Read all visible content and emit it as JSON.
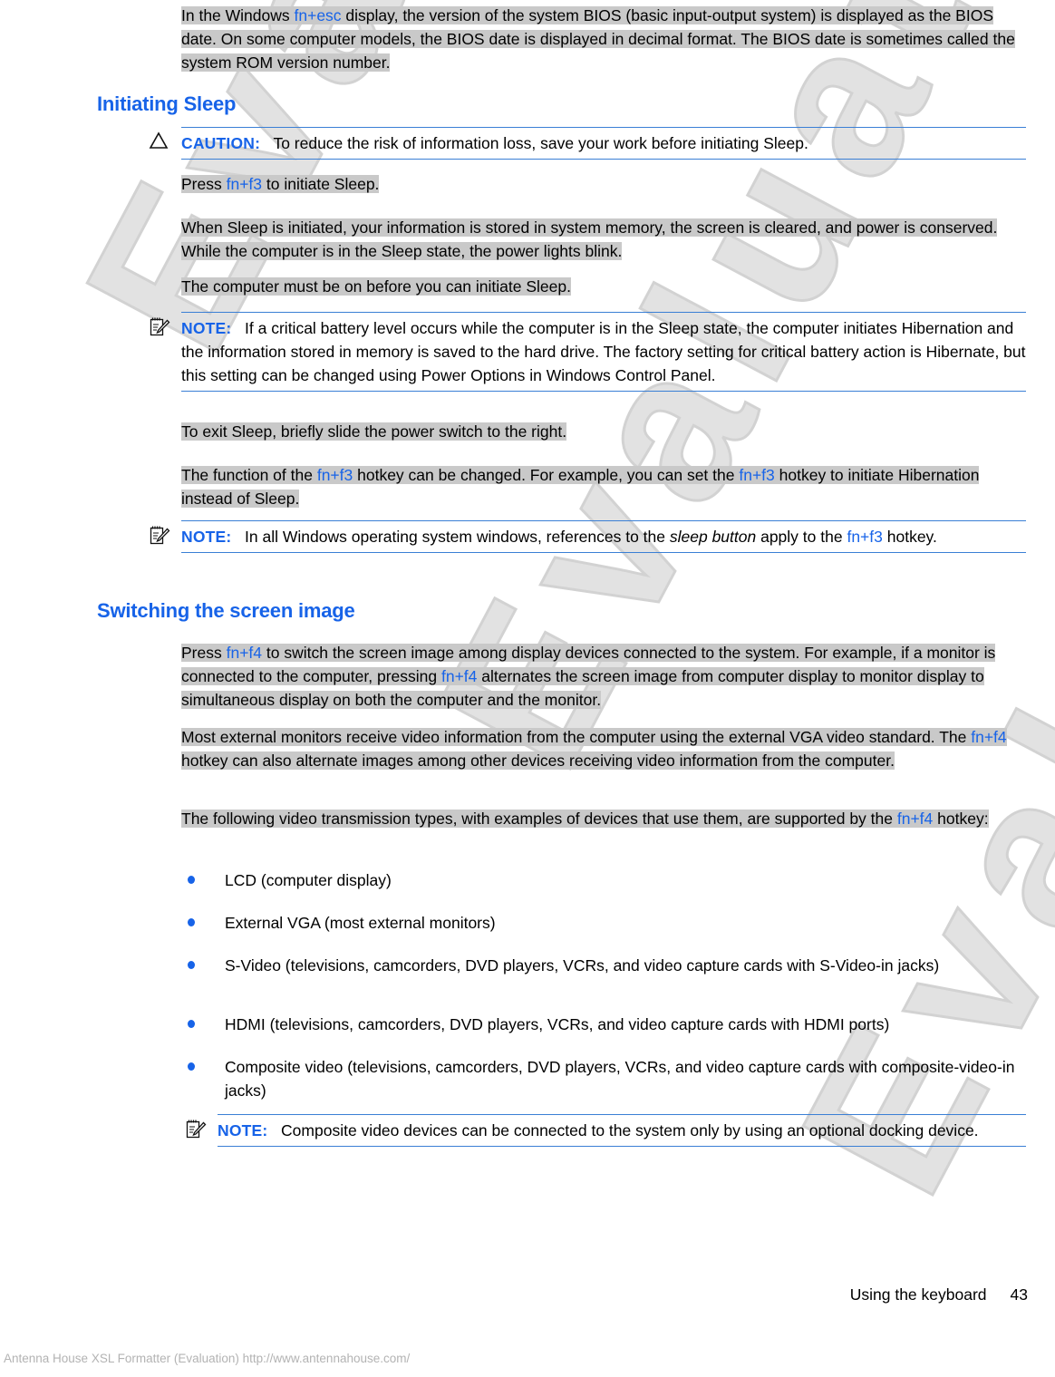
{
  "document": {
    "footer": {
      "section_title": "Using the keyboard",
      "page_number": "43"
    },
    "evaluation_notice": "Antenna House XSL Formatter (Evaluation)  http://www.antennahouse.com/",
    "watermark_text": "Evaluation"
  },
  "intro_paragraph": {
    "before_key": "In the Windows ",
    "key": "fn+esc",
    "after_key": " display, the version of the system BIOS (basic input-output system) is displayed as the BIOS date. On some computer models, the BIOS date is displayed in decimal format. The BIOS date is sometimes called the system ROM version number."
  },
  "sections": [
    {
      "heading": "Initiating Sleep",
      "caution": {
        "icon": "warning-triangle-icon",
        "label": "CAUTION:",
        "text": "To reduce the risk of information loss, save your work before initiating Sleep."
      },
      "paragraphs": [
        {
          "id": "press-fn-f3",
          "before_key": "Press ",
          "key": "fn+f3",
          "after_key": " to initiate Sleep."
        },
        {
          "id": "sleep-behavior",
          "text": "When Sleep is initiated, your information is stored in system memory, the screen is cleared, and power is conserved. While the computer is in the Sleep state, the power lights blink."
        },
        {
          "id": "computer-must-be-on",
          "text": "The computer must be on before you can initiate Sleep."
        }
      ],
      "note_critical_battery": {
        "icon": "note-pad-pencil-icon",
        "label": "NOTE:",
        "text": "If a critical battery level occurs while the computer is in the Sleep state, the computer initiates Hibernation and the information stored in memory is saved to the hard drive. The factory setting for critical battery action is Hibernate, but this setting can be changed using Power Options in Windows Control Panel."
      },
      "paragraphs_after": [
        {
          "id": "exit-sleep",
          "text": "To exit Sleep, briefly slide the power switch to the right."
        },
        {
          "id": "function-change",
          "part1": "The function of the ",
          "key1": "fn+f3",
          "part2": " hotkey can be changed. For example, you can set the ",
          "key2": "fn+f3",
          "part3": " hotkey to initiate Hibernation instead of Sleep."
        }
      ],
      "note_sleep_button": {
        "icon": "note-pad-pencil-icon",
        "label": "NOTE:",
        "part1": "In all Windows operating system windows, references to the ",
        "italic": "sleep button",
        "part2": " apply to the ",
        "key": "fn+f3",
        "part3": " hotkey."
      }
    },
    {
      "heading": "Switching the screen image",
      "paragraphs": [
        {
          "id": "press-fn-f4",
          "part1": "Press ",
          "key1": "fn+f4",
          "part2": " to switch the screen image among display devices connected to the system. For example, if a monitor is connected to the computer, pressing ",
          "key2": "fn+f4",
          "part3": " alternates the screen image from computer display to monitor display to simultaneous display on both the computer and the monitor."
        },
        {
          "id": "external-monitors",
          "part1": "Most external monitors receive video information from the computer using the external VGA video standard. The ",
          "key1": "fn+f4",
          "part2": " hotkey can also alternate images among other devices receiving video information from the computer."
        },
        {
          "id": "transmission-types",
          "part1": "The following video transmission types, with examples of devices that use them, are supported by the ",
          "key1": "fn+f4",
          "part2": " hotkey:"
        }
      ],
      "bullets": [
        "LCD (computer display)",
        "External VGA (most external monitors)",
        "S-Video (televisions, camcorders, DVD players, VCRs, and video capture cards with S-Video-in jacks)",
        "HDMI (televisions, camcorders, DVD players, VCRs, and video capture cards with HDMI ports)",
        "Composite video (televisions, camcorders, DVD players, VCRs, and video capture cards with composite-video-in jacks)"
      ],
      "note_composite": {
        "icon": "note-pad-pencil-icon",
        "label": "NOTE:",
        "text": "Composite video devices can be connected to the system only by using an optional docking device."
      }
    }
  ],
  "colors": {
    "accent_blue": "#1763e8",
    "rule_blue": "#3a7fd5",
    "highlight_gray": "#c9c9c9",
    "watermark_gray": "#e2e2e2"
  }
}
